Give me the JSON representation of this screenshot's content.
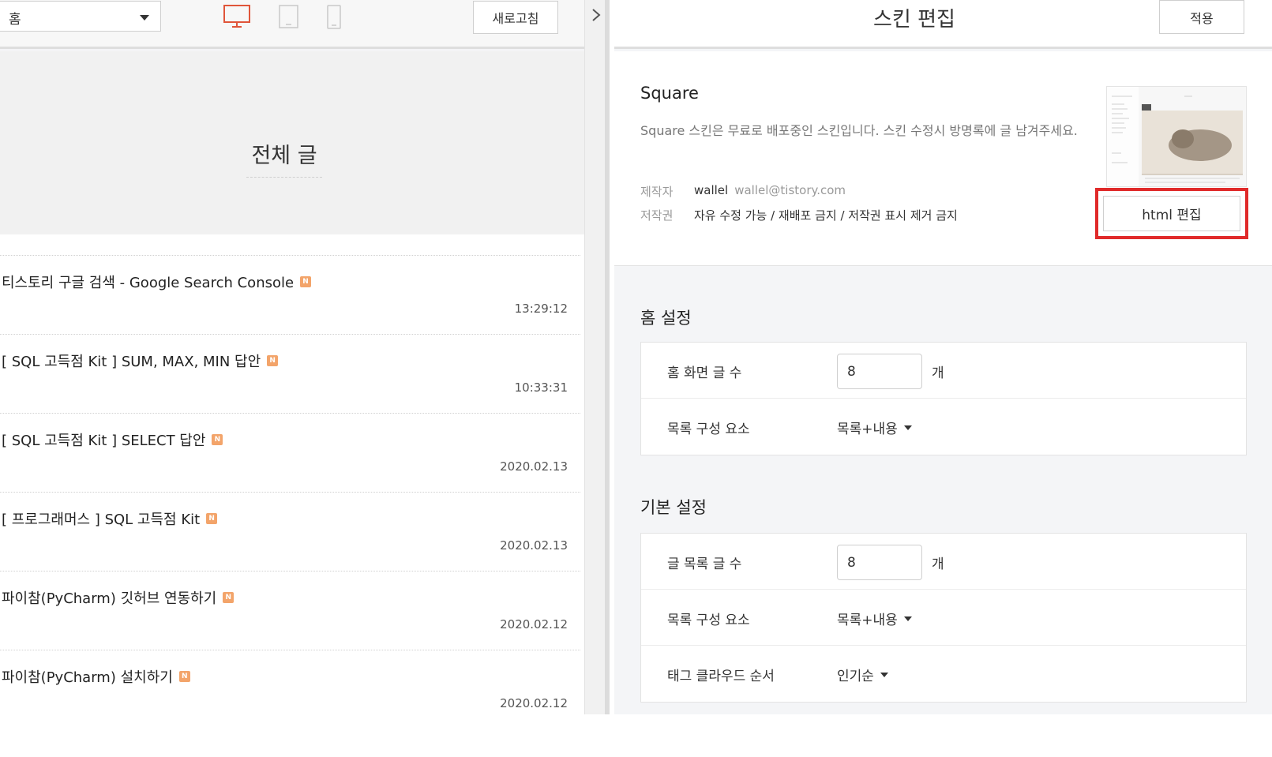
{
  "left": {
    "page_select": {
      "value": "홈"
    },
    "devices": {
      "pc": "pc-monitor-icon",
      "tablet": "tablet-icon",
      "mobile": "mobile-icon"
    },
    "refresh_label": "새로고침",
    "hero_title": "전체 글",
    "new_badge": "N",
    "posts": [
      {
        "title": "티스토리 구글 검색 - Google Search Console",
        "date": "13:29:12"
      },
      {
        "title": "[ SQL 고득점 Kit ] SUM, MAX, MIN 답안",
        "date": "10:33:31"
      },
      {
        "title": "[ SQL 고득점 Kit ] SELECT 답안",
        "date": "2020.02.13"
      },
      {
        "title": "[ 프로그래머스 ] SQL 고득점 Kit",
        "date": "2020.02.13"
      },
      {
        "title": "파이참(PyCharm) 깃허브 연동하기",
        "date": "2020.02.12"
      },
      {
        "title": "파이참(PyCharm) 설치하기",
        "date": "2020.02.12"
      }
    ]
  },
  "right": {
    "title": "스킨 편집",
    "apply_label": "적용",
    "skin": {
      "name": "Square",
      "description": "Square 스킨은 무료로 배포중인 스킨입니다. 스킨 수정시 방명록에 글 남겨주세요.",
      "author_label": "제작자",
      "author_name": "wallel",
      "author_email": "wallel@tistory.com",
      "license_label": "저작권",
      "license_value": "자유 수정 가능 / 재배포 금지 / 저작권 표시 제거 금지",
      "html_edit_label": "html 편집"
    },
    "home_settings": {
      "title": "홈 설정",
      "post_count_label": "홈 화면 글 수",
      "post_count_value": "8",
      "unit": "개",
      "list_elements_label": "목록 구성 요소",
      "list_elements_value": "목록+내용"
    },
    "basic_settings": {
      "title": "기본 설정",
      "post_count_label": "글 목록 글 수",
      "post_count_value": "8",
      "unit": "개",
      "list_elements_label": "목록 구성 요소",
      "list_elements_value": "목록+내용",
      "tag_cloud_label": "태그 클라우드 순서",
      "tag_cloud_value": "인기순"
    }
  },
  "colors": {
    "highlight": "#e02a2a",
    "pc_icon": "#e0553a",
    "badge": "#f3a46a"
  }
}
